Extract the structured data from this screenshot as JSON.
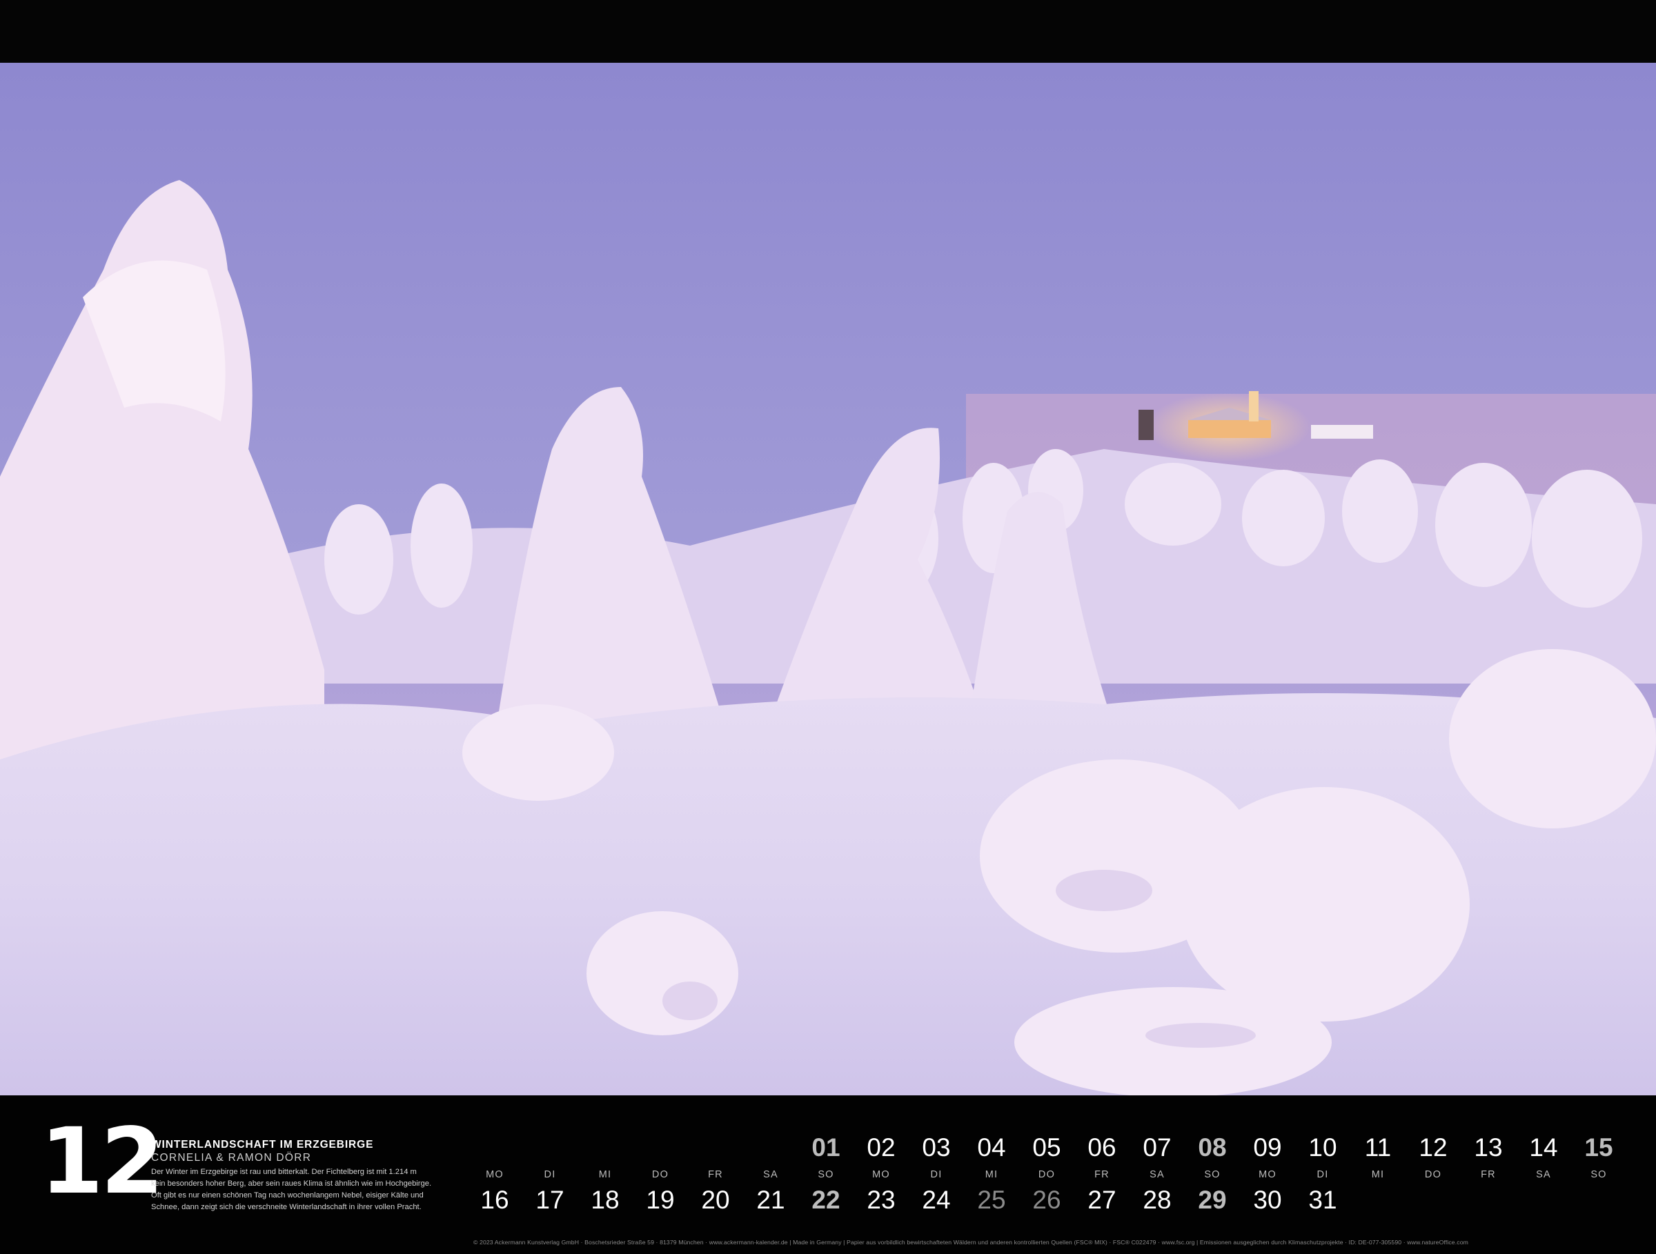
{
  "calendar": {
    "month_number": "12",
    "caption_title": "WINTERLANDSCHAFT IM ERZGEBIRGE",
    "caption_credit": "CORNELIA & RAMON DÖRR",
    "caption_lines": [
      "Der Winter im Erzgebirge ist rau und bitterkalt. Der Fichtelberg ist mit 1.214 m",
      "kein besonders hoher Berg, aber sein raues Klima ist ähnlich wie im Hochgebirge.",
      "Oft gibt es nur einen schönen Tag nach wochenlangem Nebel, eisiger Kälte und",
      "Schnee, dann zeigt sich die verschneite Winterlandschaft in ihrer vollen Pracht."
    ],
    "top_row": {
      "days": [
        "01",
        "02",
        "03",
        "04",
        "05",
        "06",
        "07",
        "08",
        "09",
        "10",
        "11",
        "12",
        "13",
        "14",
        "15"
      ],
      "weekdays": [
        "SO",
        "MO",
        "DI",
        "MI",
        "DO",
        "FR",
        "SA",
        "SO",
        "MO",
        "DI",
        "MI",
        "DO",
        "FR",
        "SA",
        "SO"
      ]
    },
    "bottom_row": {
      "weekdays": [
        "MO",
        "DI",
        "MI",
        "DO",
        "FR",
        "SA",
        "SO",
        "MO",
        "DI",
        "MI",
        "DO",
        "FR",
        "SA",
        "SO",
        "MO",
        "DI"
      ],
      "days": [
        "16",
        "17",
        "18",
        "19",
        "20",
        "21",
        "22",
        "23",
        "24",
        "25",
        "26",
        "27",
        "28",
        "29",
        "30",
        "31"
      ]
    },
    "footer": "© 2023 Ackermann Kunstverlag GmbH · Boschetsrieder Straße 59 · 81379 München · www.ackermann-kalender.de  |  Made in Germany  |  Papier aus vorbildlich bewirtschafteten Wäldern und anderen kontrollierten Quellen (FSC® MIX) · FSC® C022479 · www.fsc.org  |  Emissionen ausgeglichen durch Klimaschutzprojekte · ID: DE-077-305590 · www.natureOffice.com"
  },
  "colors": {
    "sky_top": "#8f8ad0",
    "sky_horizon": "#e8b3d1",
    "snow": "#f4ecf8",
    "background": "#020202"
  }
}
